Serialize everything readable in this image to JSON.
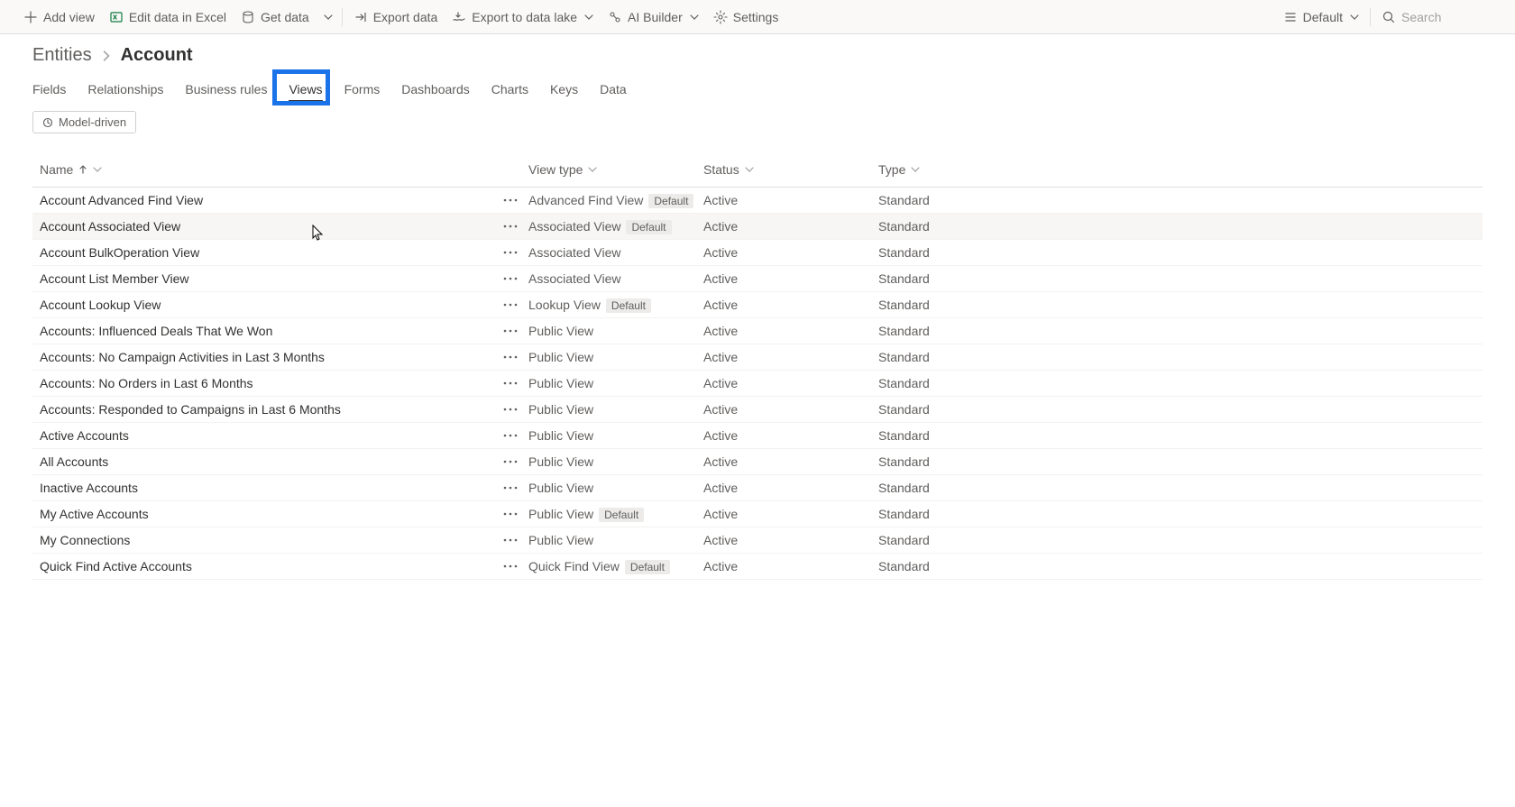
{
  "commandbar": {
    "add_view": "Add view",
    "edit_excel": "Edit data in Excel",
    "get_data": "Get data",
    "export_data": "Export data",
    "export_lake": "Export to data lake",
    "ai_builder": "AI Builder",
    "settings": "Settings",
    "default": "Default",
    "search_placeholder": "Search"
  },
  "breadcrumb": {
    "root": "Entities",
    "current": "Account"
  },
  "tabs": [
    {
      "label": "Fields"
    },
    {
      "label": "Relationships"
    },
    {
      "label": "Business rules"
    },
    {
      "label": "Views",
      "active": true
    },
    {
      "label": "Forms"
    },
    {
      "label": "Dashboards"
    },
    {
      "label": "Charts"
    },
    {
      "label": "Keys"
    },
    {
      "label": "Data"
    }
  ],
  "filter_pill": "Model-driven",
  "columns": {
    "name": "Name",
    "viewtype": "View type",
    "status": "Status",
    "type": "Type"
  },
  "rows": [
    {
      "name": "Account Advanced Find View",
      "viewtype": "Advanced Find View",
      "default": true,
      "status": "Active",
      "type": "Standard"
    },
    {
      "name": "Account Associated View",
      "viewtype": "Associated View",
      "default": true,
      "status": "Active",
      "type": "Standard",
      "hovered": true
    },
    {
      "name": "Account BulkOperation View",
      "viewtype": "Associated View",
      "default": false,
      "status": "Active",
      "type": "Standard"
    },
    {
      "name": "Account List Member View",
      "viewtype": "Associated View",
      "default": false,
      "status": "Active",
      "type": "Standard"
    },
    {
      "name": "Account Lookup View",
      "viewtype": "Lookup View",
      "default": true,
      "status": "Active",
      "type": "Standard"
    },
    {
      "name": "Accounts: Influenced Deals That We Won",
      "viewtype": "Public View",
      "default": false,
      "status": "Active",
      "type": "Standard"
    },
    {
      "name": "Accounts: No Campaign Activities in Last 3 Months",
      "viewtype": "Public View",
      "default": false,
      "status": "Active",
      "type": "Standard"
    },
    {
      "name": "Accounts: No Orders in Last 6 Months",
      "viewtype": "Public View",
      "default": false,
      "status": "Active",
      "type": "Standard"
    },
    {
      "name": "Accounts: Responded to Campaigns in Last 6 Months",
      "viewtype": "Public View",
      "default": false,
      "status": "Active",
      "type": "Standard"
    },
    {
      "name": "Active Accounts",
      "viewtype": "Public View",
      "default": false,
      "status": "Active",
      "type": "Standard"
    },
    {
      "name": "All Accounts",
      "viewtype": "Public View",
      "default": false,
      "status": "Active",
      "type": "Standard"
    },
    {
      "name": "Inactive Accounts",
      "viewtype": "Public View",
      "default": false,
      "status": "Active",
      "type": "Standard"
    },
    {
      "name": "My Active Accounts",
      "viewtype": "Public View",
      "default": true,
      "status": "Active",
      "type": "Standard"
    },
    {
      "name": "My Connections",
      "viewtype": "Public View",
      "default": false,
      "status": "Active",
      "type": "Standard"
    },
    {
      "name": "Quick Find Active Accounts",
      "viewtype": "Quick Find View",
      "default": true,
      "status": "Active",
      "type": "Standard"
    }
  ],
  "default_badge": "Default"
}
